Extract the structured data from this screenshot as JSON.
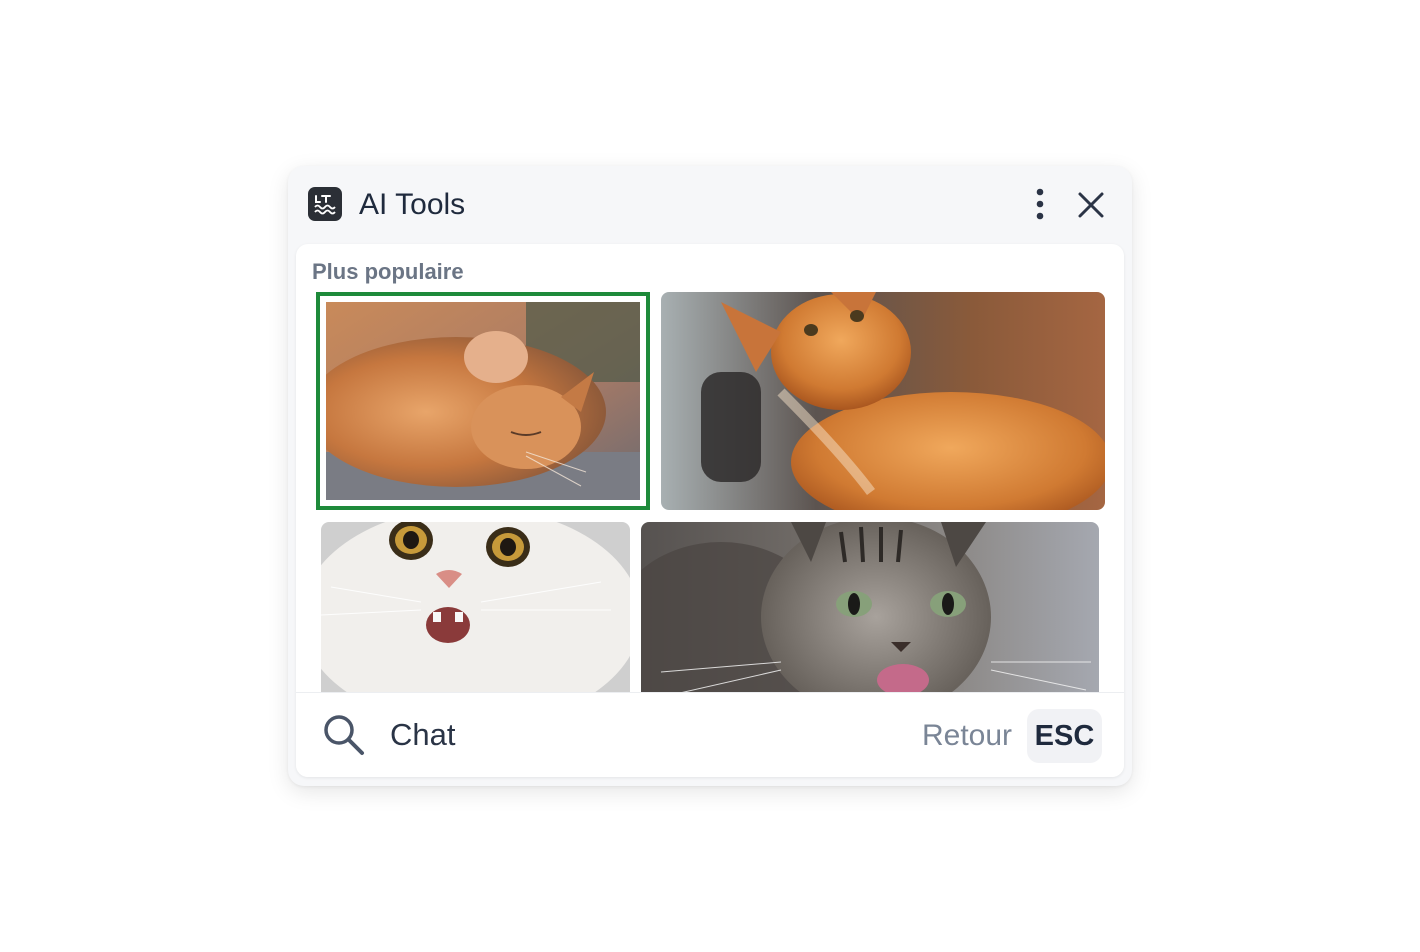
{
  "header": {
    "title": "AI Tools",
    "logo_icon": "lt-wave-logo-icon",
    "more_icon": "vertical-dots-icon",
    "close_icon": "close-icon"
  },
  "section": {
    "label": "Plus populaire"
  },
  "gallery": {
    "items": [
      {
        "subject": "orange cat rolling on its back",
        "selected": true
      },
      {
        "subject": "orange cat looking up",
        "selected": false
      },
      {
        "subject": "white cat with wide eyes",
        "selected": false
      },
      {
        "subject": "tabby cat licking lips",
        "selected": false
      }
    ]
  },
  "search": {
    "value": "Chat",
    "icon": "search-icon"
  },
  "footer": {
    "back_label": "Retour",
    "esc_key": "ESC"
  },
  "colors": {
    "selection": "#1e8a3a",
    "title_text": "#1f2a3d",
    "muted_text": "#6b7585"
  }
}
